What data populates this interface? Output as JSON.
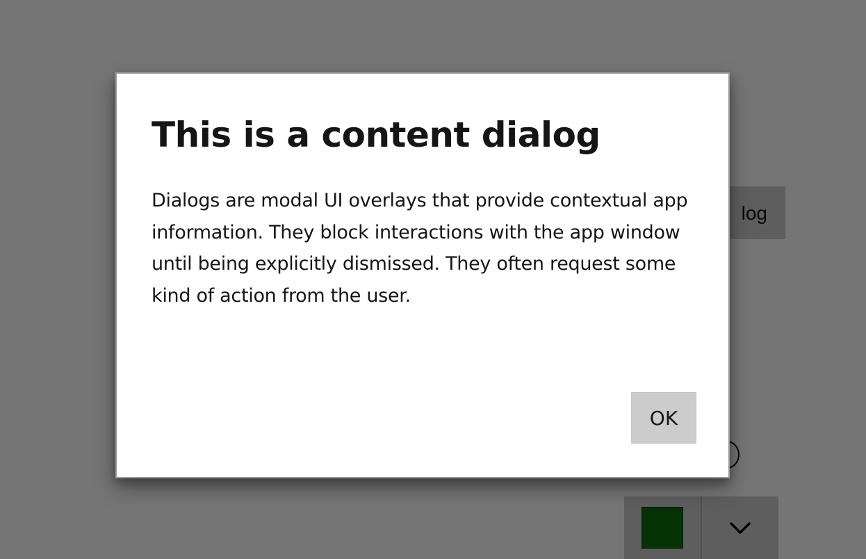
{
  "background": {
    "dialog_button_partial_label": "log"
  },
  "dialog": {
    "title": "This is a content dialog",
    "body": "Dialogs are modal UI overlays that provide contextual app information. They block interactions with the app window until being explicitly dismissed. They often request some kind of action from the user.",
    "primary_button_label": "OK"
  },
  "icons": {
    "split_button_arrow": "chevron-down-icon",
    "color_swatch": "color-swatch-icon"
  },
  "colors": {
    "overlay": "#757575",
    "swatch": "#0f6f0f"
  }
}
